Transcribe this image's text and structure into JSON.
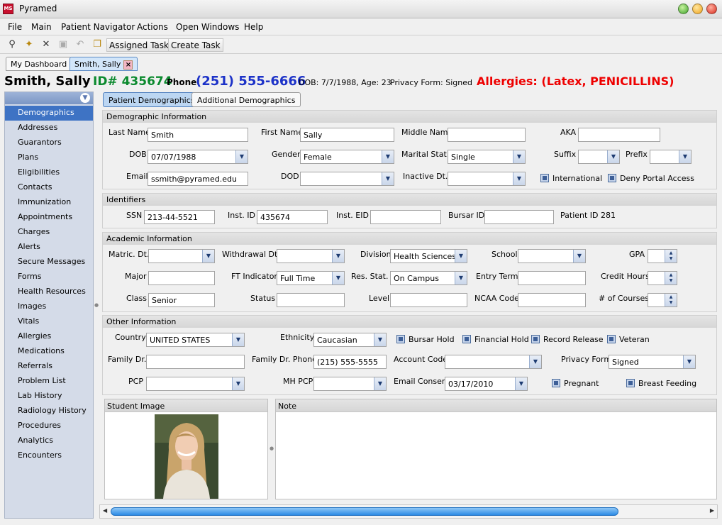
{
  "window": {
    "title": "Pyramed",
    "icon_text": "MS"
  },
  "menu": [
    "File",
    "Main",
    "Patient Navigator",
    "Actions",
    "Open Windows",
    "Help"
  ],
  "toolbar": {
    "assigned_tasks": "Assigned Tasks",
    "create_task": "Create Task"
  },
  "tabs": {
    "dashboard": "My Dashboard",
    "patient": "Smith, Sally",
    "close": "×"
  },
  "patient": {
    "name": "Smith, Sally",
    "id": "ID# 435674",
    "phone_label": "Phone:",
    "phone": "(251) 555-6666",
    "dob_age": "DOB: 7/7/1988, Age: 23",
    "privacy": "Privacy Form:  Signed",
    "allergies": "Allergies: (Latex, PENICILLINS)"
  },
  "sidebar": [
    "Demographics",
    "Addresses",
    "Guarantors",
    "Plans",
    "Eligibilities",
    "Contacts",
    "Immunization",
    "Appointments",
    "Charges",
    "Alerts",
    "Secure Messages",
    "Forms",
    "Health Resources",
    "Images",
    "Vitals",
    "Allergies",
    "Medications",
    "Referrals",
    "Problem List",
    "Lab History",
    "Radiology History",
    "Procedures",
    "Analytics",
    "Encounters"
  ],
  "subtabs": {
    "patient_demographics": "Patient Demographics",
    "additional_demographics": "Additional Demographics"
  },
  "demo": {
    "title": "Demographic Information",
    "last_name_l": "Last Name",
    "last_name": "Smith",
    "first_name_l": "First Name",
    "first_name": "Sally",
    "middle_name_l": "Middle Name",
    "middle_name": "",
    "aka_l": "AKA",
    "aka": "",
    "dob_l": "DOB",
    "dob": "07/07/1988",
    "gender_l": "Gender",
    "gender": "Female",
    "marital_l": "Marital Stat.",
    "marital": "Single",
    "suffix_l": "Suffix",
    "suffix": "",
    "prefix_l": "Prefix",
    "prefix": "",
    "email_l": "Email",
    "email": "ssmith@pyramed.edu",
    "dod_l": "DOD",
    "dod": "",
    "inactive_l": "Inactive Dt.",
    "inactive": "",
    "international": "International",
    "deny_portal": "Deny Portal Access"
  },
  "ident": {
    "title": "Identifiers",
    "ssn_l": "SSN",
    "ssn": "213-44-5521",
    "inst_id_l": "Inst. ID",
    "inst_id": "435674",
    "inst_eid_l": "Inst. EID",
    "inst_eid": "",
    "bursar_l": "Bursar ID",
    "bursar": "",
    "patient_id": "Patient ID 281"
  },
  "acad": {
    "title": "Academic Information",
    "matric_l": "Matric. Dt.",
    "matric": "",
    "withdrawal_l": "Withdrawal Dt.",
    "withdrawal": "",
    "division_l": "Division",
    "division": "Health Sciences",
    "school_l": "School",
    "school": "",
    "gpa_l": "GPA",
    "gpa": "",
    "major_l": "Major",
    "major": "",
    "ft_l": "FT Indicator",
    "ft": "Full Time",
    "res_l": "Res. Stat.",
    "res": "On Campus",
    "entry_l": "Entry Term",
    "entry": "",
    "credit_l": "Credit Hours",
    "credit": "",
    "class_l": "Class",
    "class": "Senior",
    "status_l": "Status",
    "status": "",
    "level_l": "Level",
    "level": "",
    "ncaa_l": "NCAA Code",
    "ncaa": "",
    "courses_l": "# of Courses",
    "courses": ""
  },
  "other": {
    "title": "Other Information",
    "country_l": "Country",
    "country": "UNITED STATES",
    "ethnicity_l": "Ethnicity",
    "ethnicity": "Caucasian",
    "bursar_hold": "Bursar Hold",
    "financial_hold": "Financial Hold",
    "record_release": "Record Release",
    "veteran": "Veteran",
    "family_dr_l": "Family Dr.",
    "family_dr": "",
    "family_phone_l": "Family Dr. Phone",
    "family_phone": "(215) 555-5555",
    "account_l": "Account Code",
    "account": "",
    "privacy_l": "Privacy Form",
    "privacy": "Signed",
    "pcp_l": "PCP",
    "pcp": "",
    "mhpcp_l": "MH PCP",
    "mhpcp": "",
    "email_consent_l": "Email Consent",
    "email_consent": "03/17/2010",
    "pregnant": "Pregnant",
    "breast_feeding": "Breast Feeding"
  },
  "panels": {
    "student_image": "Student Image",
    "note": "Note"
  }
}
